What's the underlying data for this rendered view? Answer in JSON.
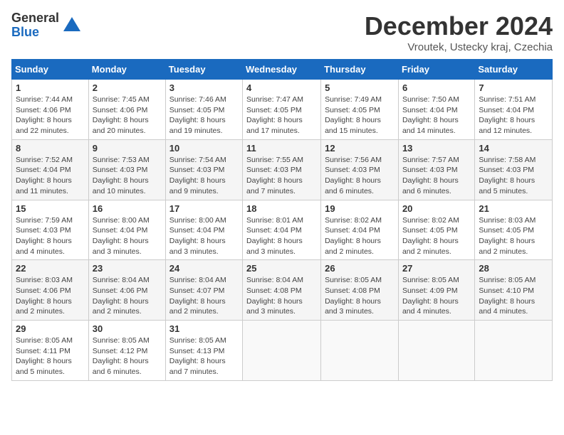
{
  "logo": {
    "general": "General",
    "blue": "Blue"
  },
  "title": "December 2024",
  "location": "Vroutek, Ustecky kraj, Czechia",
  "days_header": [
    "Sunday",
    "Monday",
    "Tuesday",
    "Wednesday",
    "Thursday",
    "Friday",
    "Saturday"
  ],
  "weeks": [
    [
      {
        "day": "1",
        "sunrise": "7:44 AM",
        "sunset": "4:06 PM",
        "daylight": "8 hours and 22 minutes."
      },
      {
        "day": "2",
        "sunrise": "7:45 AM",
        "sunset": "4:06 PM",
        "daylight": "8 hours and 20 minutes."
      },
      {
        "day": "3",
        "sunrise": "7:46 AM",
        "sunset": "4:05 PM",
        "daylight": "8 hours and 19 minutes."
      },
      {
        "day": "4",
        "sunrise": "7:47 AM",
        "sunset": "4:05 PM",
        "daylight": "8 hours and 17 minutes."
      },
      {
        "day": "5",
        "sunrise": "7:49 AM",
        "sunset": "4:05 PM",
        "daylight": "8 hours and 15 minutes."
      },
      {
        "day": "6",
        "sunrise": "7:50 AM",
        "sunset": "4:04 PM",
        "daylight": "8 hours and 14 minutes."
      },
      {
        "day": "7",
        "sunrise": "7:51 AM",
        "sunset": "4:04 PM",
        "daylight": "8 hours and 12 minutes."
      }
    ],
    [
      {
        "day": "8",
        "sunrise": "7:52 AM",
        "sunset": "4:04 PM",
        "daylight": "8 hours and 11 minutes."
      },
      {
        "day": "9",
        "sunrise": "7:53 AM",
        "sunset": "4:03 PM",
        "daylight": "8 hours and 10 minutes."
      },
      {
        "day": "10",
        "sunrise": "7:54 AM",
        "sunset": "4:03 PM",
        "daylight": "8 hours and 9 minutes."
      },
      {
        "day": "11",
        "sunrise": "7:55 AM",
        "sunset": "4:03 PM",
        "daylight": "8 hours and 7 minutes."
      },
      {
        "day": "12",
        "sunrise": "7:56 AM",
        "sunset": "4:03 PM",
        "daylight": "8 hours and 6 minutes."
      },
      {
        "day": "13",
        "sunrise": "7:57 AM",
        "sunset": "4:03 PM",
        "daylight": "8 hours and 6 minutes."
      },
      {
        "day": "14",
        "sunrise": "7:58 AM",
        "sunset": "4:03 PM",
        "daylight": "8 hours and 5 minutes."
      }
    ],
    [
      {
        "day": "15",
        "sunrise": "7:59 AM",
        "sunset": "4:03 PM",
        "daylight": "8 hours and 4 minutes."
      },
      {
        "day": "16",
        "sunrise": "8:00 AM",
        "sunset": "4:04 PM",
        "daylight": "8 hours and 3 minutes."
      },
      {
        "day": "17",
        "sunrise": "8:00 AM",
        "sunset": "4:04 PM",
        "daylight": "8 hours and 3 minutes."
      },
      {
        "day": "18",
        "sunrise": "8:01 AM",
        "sunset": "4:04 PM",
        "daylight": "8 hours and 3 minutes."
      },
      {
        "day": "19",
        "sunrise": "8:02 AM",
        "sunset": "4:04 PM",
        "daylight": "8 hours and 2 minutes."
      },
      {
        "day": "20",
        "sunrise": "8:02 AM",
        "sunset": "4:05 PM",
        "daylight": "8 hours and 2 minutes."
      },
      {
        "day": "21",
        "sunrise": "8:03 AM",
        "sunset": "4:05 PM",
        "daylight": "8 hours and 2 minutes."
      }
    ],
    [
      {
        "day": "22",
        "sunrise": "8:03 AM",
        "sunset": "4:06 PM",
        "daylight": "8 hours and 2 minutes."
      },
      {
        "day": "23",
        "sunrise": "8:04 AM",
        "sunset": "4:06 PM",
        "daylight": "8 hours and 2 minutes."
      },
      {
        "day": "24",
        "sunrise": "8:04 AM",
        "sunset": "4:07 PM",
        "daylight": "8 hours and 2 minutes."
      },
      {
        "day": "25",
        "sunrise": "8:04 AM",
        "sunset": "4:08 PM",
        "daylight": "8 hours and 3 minutes."
      },
      {
        "day": "26",
        "sunrise": "8:05 AM",
        "sunset": "4:08 PM",
        "daylight": "8 hours and 3 minutes."
      },
      {
        "day": "27",
        "sunrise": "8:05 AM",
        "sunset": "4:09 PM",
        "daylight": "8 hours and 4 minutes."
      },
      {
        "day": "28",
        "sunrise": "8:05 AM",
        "sunset": "4:10 PM",
        "daylight": "8 hours and 4 minutes."
      }
    ],
    [
      {
        "day": "29",
        "sunrise": "8:05 AM",
        "sunset": "4:11 PM",
        "daylight": "8 hours and 5 minutes."
      },
      {
        "day": "30",
        "sunrise": "8:05 AM",
        "sunset": "4:12 PM",
        "daylight": "8 hours and 6 minutes."
      },
      {
        "day": "31",
        "sunrise": "8:05 AM",
        "sunset": "4:13 PM",
        "daylight": "8 hours and 7 minutes."
      },
      null,
      null,
      null,
      null
    ]
  ]
}
